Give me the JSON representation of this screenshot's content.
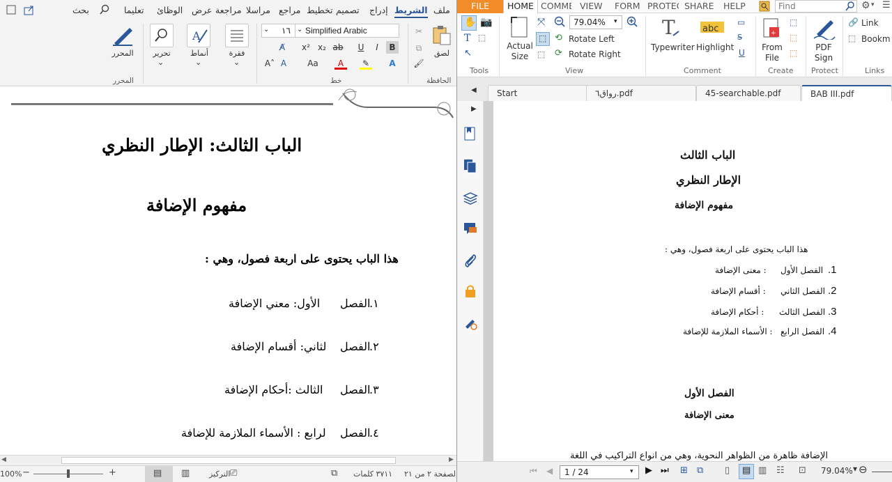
{
  "word": {
    "tabs": {
      "search": "بحث",
      "file": "ملف",
      "home": "الشريط",
      "insert": "إدراج",
      "design": "تصميم",
      "layout": "تخطيط",
      "references": "مراجع",
      "mailings": "مراسلا",
      "review": "مراجعة",
      "view": "عرض",
      "addins": "الوظائ",
      "help": "تعليما"
    },
    "ribbon": {
      "editor": "المحرر",
      "editor_group": "المحرر",
      "editing": "تحرير",
      "styles": "أنماط",
      "paragraph": "فقرة",
      "font_size": "١٦",
      "font_name": "Simplified Arabic",
      "font_group": "خط",
      "paste": "لصق",
      "clipboard_group": "الحافظة"
    },
    "doc": {
      "chapter_title": "الباب الثالث: الإطار النظري",
      "concept_title": "مفهوم الإضافة",
      "intro": "هذا الباب يحتوى على اربعة فصول، وهي :",
      "items": [
        {
          "num": "١.",
          "word": "الفصل",
          "title": "الأول: معني الإضافة"
        },
        {
          "num": "٢.",
          "word": "الفصل",
          "title": "لثاني: أقسام الإضافة"
        },
        {
          "num": "٣.",
          "word": "الفصل",
          "title": "الثالث :أحكام الإضافة"
        },
        {
          "num": "٤.",
          "word": "الفصل",
          "title": "لرابع : الأسماء الملازمة للإضافة"
        }
      ]
    },
    "status": {
      "zoom": "100%",
      "focus": "التركيز",
      "words": "٣٧١١ كلمات",
      "page": "الصفحة ٢ من ٢١"
    }
  },
  "pdf": {
    "tabs": [
      "FILE",
      "HOME",
      "COMME",
      "VIEW",
      "FORM",
      "PROTEC",
      "SHARE",
      "HELP"
    ],
    "find_placeholder": "Find",
    "ribbon": {
      "zoom": "79.04%",
      "actual_size": "Actual Size",
      "rotate_left": "Rotate Left",
      "rotate_right": "Rotate Right",
      "typewriter": "Typewriter",
      "highlight": "Highlight",
      "from_file": "From File",
      "pdf_sign": "PDF Sign",
      "link": "Link",
      "bookmark": "Bookm",
      "groups": {
        "tools": "Tools",
        "view": "View",
        "comment": "Comment",
        "create": "Create",
        "protect": "Protect",
        "links": "Links"
      }
    },
    "doc_tabs": [
      "Start",
      "رواق٦.pdf",
      "45-searchable.pdf",
      "BAB III.pdf"
    ],
    "page": {
      "l1": "الباب الثالث",
      "l2": "الإطار النظري",
      "l3": "مفهوم الإضافة",
      "intro": "هذا الباب يحتوى على اربعة فصول، وهي :",
      "items": [
        {
          "num": "1.",
          "word": "الفصل الأول",
          "title": ": معنى الإضافة"
        },
        {
          "num": "2.",
          "word": "الفصل الثاني",
          "title": ": أقسام الإضافة"
        },
        {
          "num": "3.",
          "word": "الفصل الثالث",
          "title": ": أحكام الإضافة"
        },
        {
          "num": "4.",
          "word": "الفصل الرابع",
          "title": ": الأسماء الملازمة للإضافة"
        }
      ],
      "section_title": "الفصل الأول",
      "section_sub": "معنى الإضافة",
      "body_line": "الإضافة ظاهرة من الظواهر النحوية، وهي من انواع التراكيب في اللغة"
    },
    "nav": {
      "page": "1 / 24",
      "zoom": "79.04%"
    }
  },
  "colors": {
    "file_tab": "#f28c28",
    "ribbon_bg": "#f3f3f3",
    "accent_blue": "#2b579a"
  }
}
